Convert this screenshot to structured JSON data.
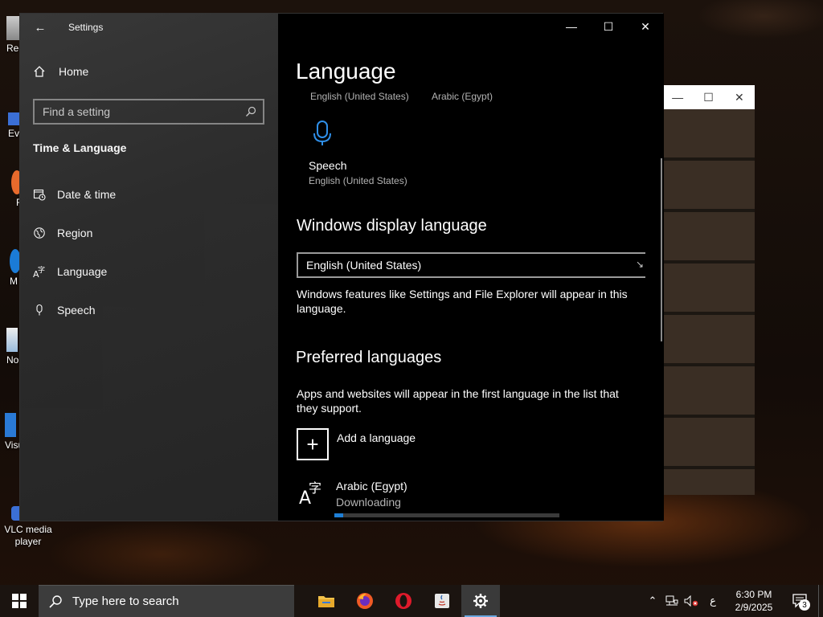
{
  "desktop": {
    "icons": [
      {
        "label": "Rec"
      },
      {
        "label": "Eve"
      },
      {
        "label": "F"
      },
      {
        "label": "M"
      },
      {
        "label": "No"
      },
      {
        "label": "Visu"
      },
      {
        "label": "VLC media player"
      }
    ]
  },
  "settings": {
    "title": "Settings",
    "home_label": "Home",
    "search_placeholder": "Find a setting",
    "section_title": "Time & Language",
    "nav_items": [
      {
        "label": "Date & time",
        "icon": "calendar-clock-icon"
      },
      {
        "label": "Region",
        "icon": "globe-icon"
      },
      {
        "label": "Language",
        "icon": "language-icon"
      },
      {
        "label": "Speech",
        "icon": "microphone-icon"
      }
    ],
    "content": {
      "page_title": "Language",
      "top_langs": [
        "English (United States)",
        "Arabic (Egypt)"
      ],
      "speech_tile": {
        "title": "Speech",
        "subtitle": "English (United States)"
      },
      "display_language_heading": "Windows display language",
      "display_language_value": "English (United States)",
      "display_language_desc": "Windows features like Settings and File Explorer will appear in this language.",
      "preferred_heading": "Preferred languages",
      "preferred_desc": "Apps and websites will appear in the first language in the list that they support.",
      "add_language_label": "Add a language",
      "language_item": {
        "name": "Arabic (Egypt)",
        "status": "Downloading",
        "progress": 0.04
      }
    }
  },
  "taskbar": {
    "search_placeholder": "Type here to search",
    "tray_language": "ع",
    "time": "6:30 PM",
    "date": "2/9/2025",
    "notification_count": "3"
  },
  "colors": {
    "accent": "#1e7fd6",
    "sidebar_bg": "#2e2e2e",
    "content_bg": "#000000"
  }
}
